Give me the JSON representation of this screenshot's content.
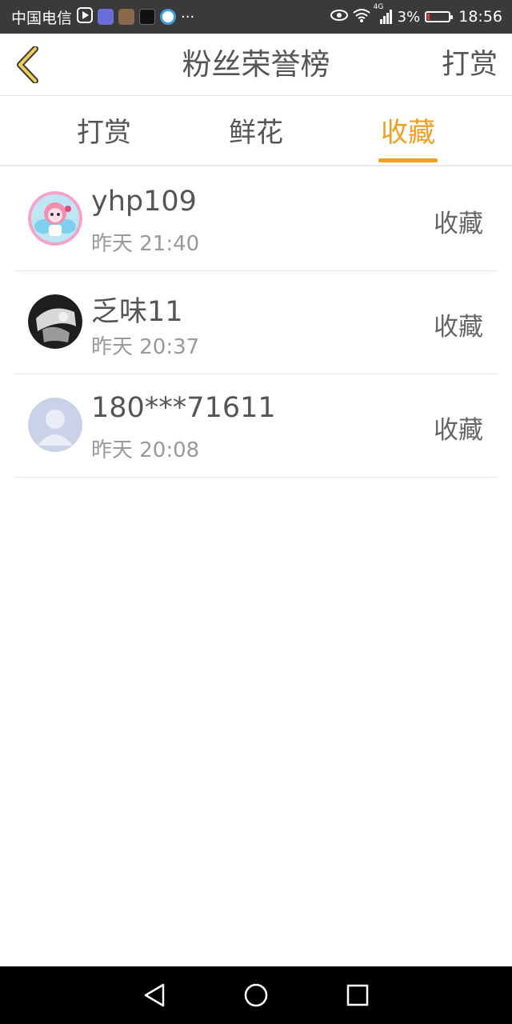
{
  "status_bar": {
    "carrier": "中国电信",
    "more": "···",
    "network": "4G",
    "battery": "3%",
    "battery_level": 0.03,
    "time": "18:56"
  },
  "header": {
    "title": "粉丝荣誉榜",
    "action_label": "打赏"
  },
  "tabs": [
    {
      "label": "打赏",
      "active": false
    },
    {
      "label": "鲜花",
      "active": false
    },
    {
      "label": "收藏",
      "active": true
    }
  ],
  "accent_color": "#f0a020",
  "list": [
    {
      "name": "yhp109",
      "time": "昨天 21:40",
      "action": "收藏"
    },
    {
      "name": "乏味11",
      "time": "昨天 20:37",
      "action": "收藏"
    },
    {
      "name": "180***71611",
      "time": "昨天 20:08",
      "action": "收藏"
    }
  ],
  "nav": {
    "back_icon": "triangle-back-icon",
    "home_icon": "circle-home-icon",
    "recents_icon": "square-recents-icon"
  }
}
